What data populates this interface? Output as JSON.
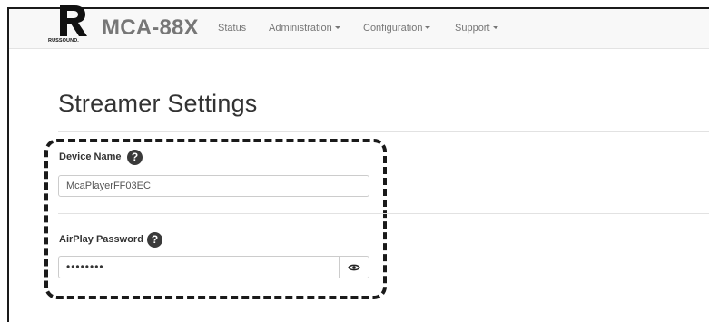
{
  "navbar": {
    "logo_letter": "R",
    "logo_caption": "RUSSOUND.",
    "brand": "MCA-88X",
    "items": [
      {
        "label": "Status",
        "dropdown": false
      },
      {
        "label": "Administration",
        "dropdown": true
      },
      {
        "label": "Configuration",
        "dropdown": true
      },
      {
        "label": "Support",
        "dropdown": true
      }
    ]
  },
  "page": {
    "title": "Streamer Settings"
  },
  "form": {
    "device_name": {
      "label": "Device Name",
      "help_icon": "question-circle-icon",
      "value": "McaPlayerFF03EC"
    },
    "airplay_password": {
      "label": "AirPlay Password",
      "help_icon": "question-circle-icon",
      "value": "••••••••",
      "toggle_icon": "eye-icon"
    }
  },
  "help_glyph": "?",
  "colors": {
    "navbar_bg": "#f8f8f8",
    "nav_text": "#777777",
    "help_icon_bg": "#3a3a3a",
    "highlight_border": "#1a1a1a"
  }
}
